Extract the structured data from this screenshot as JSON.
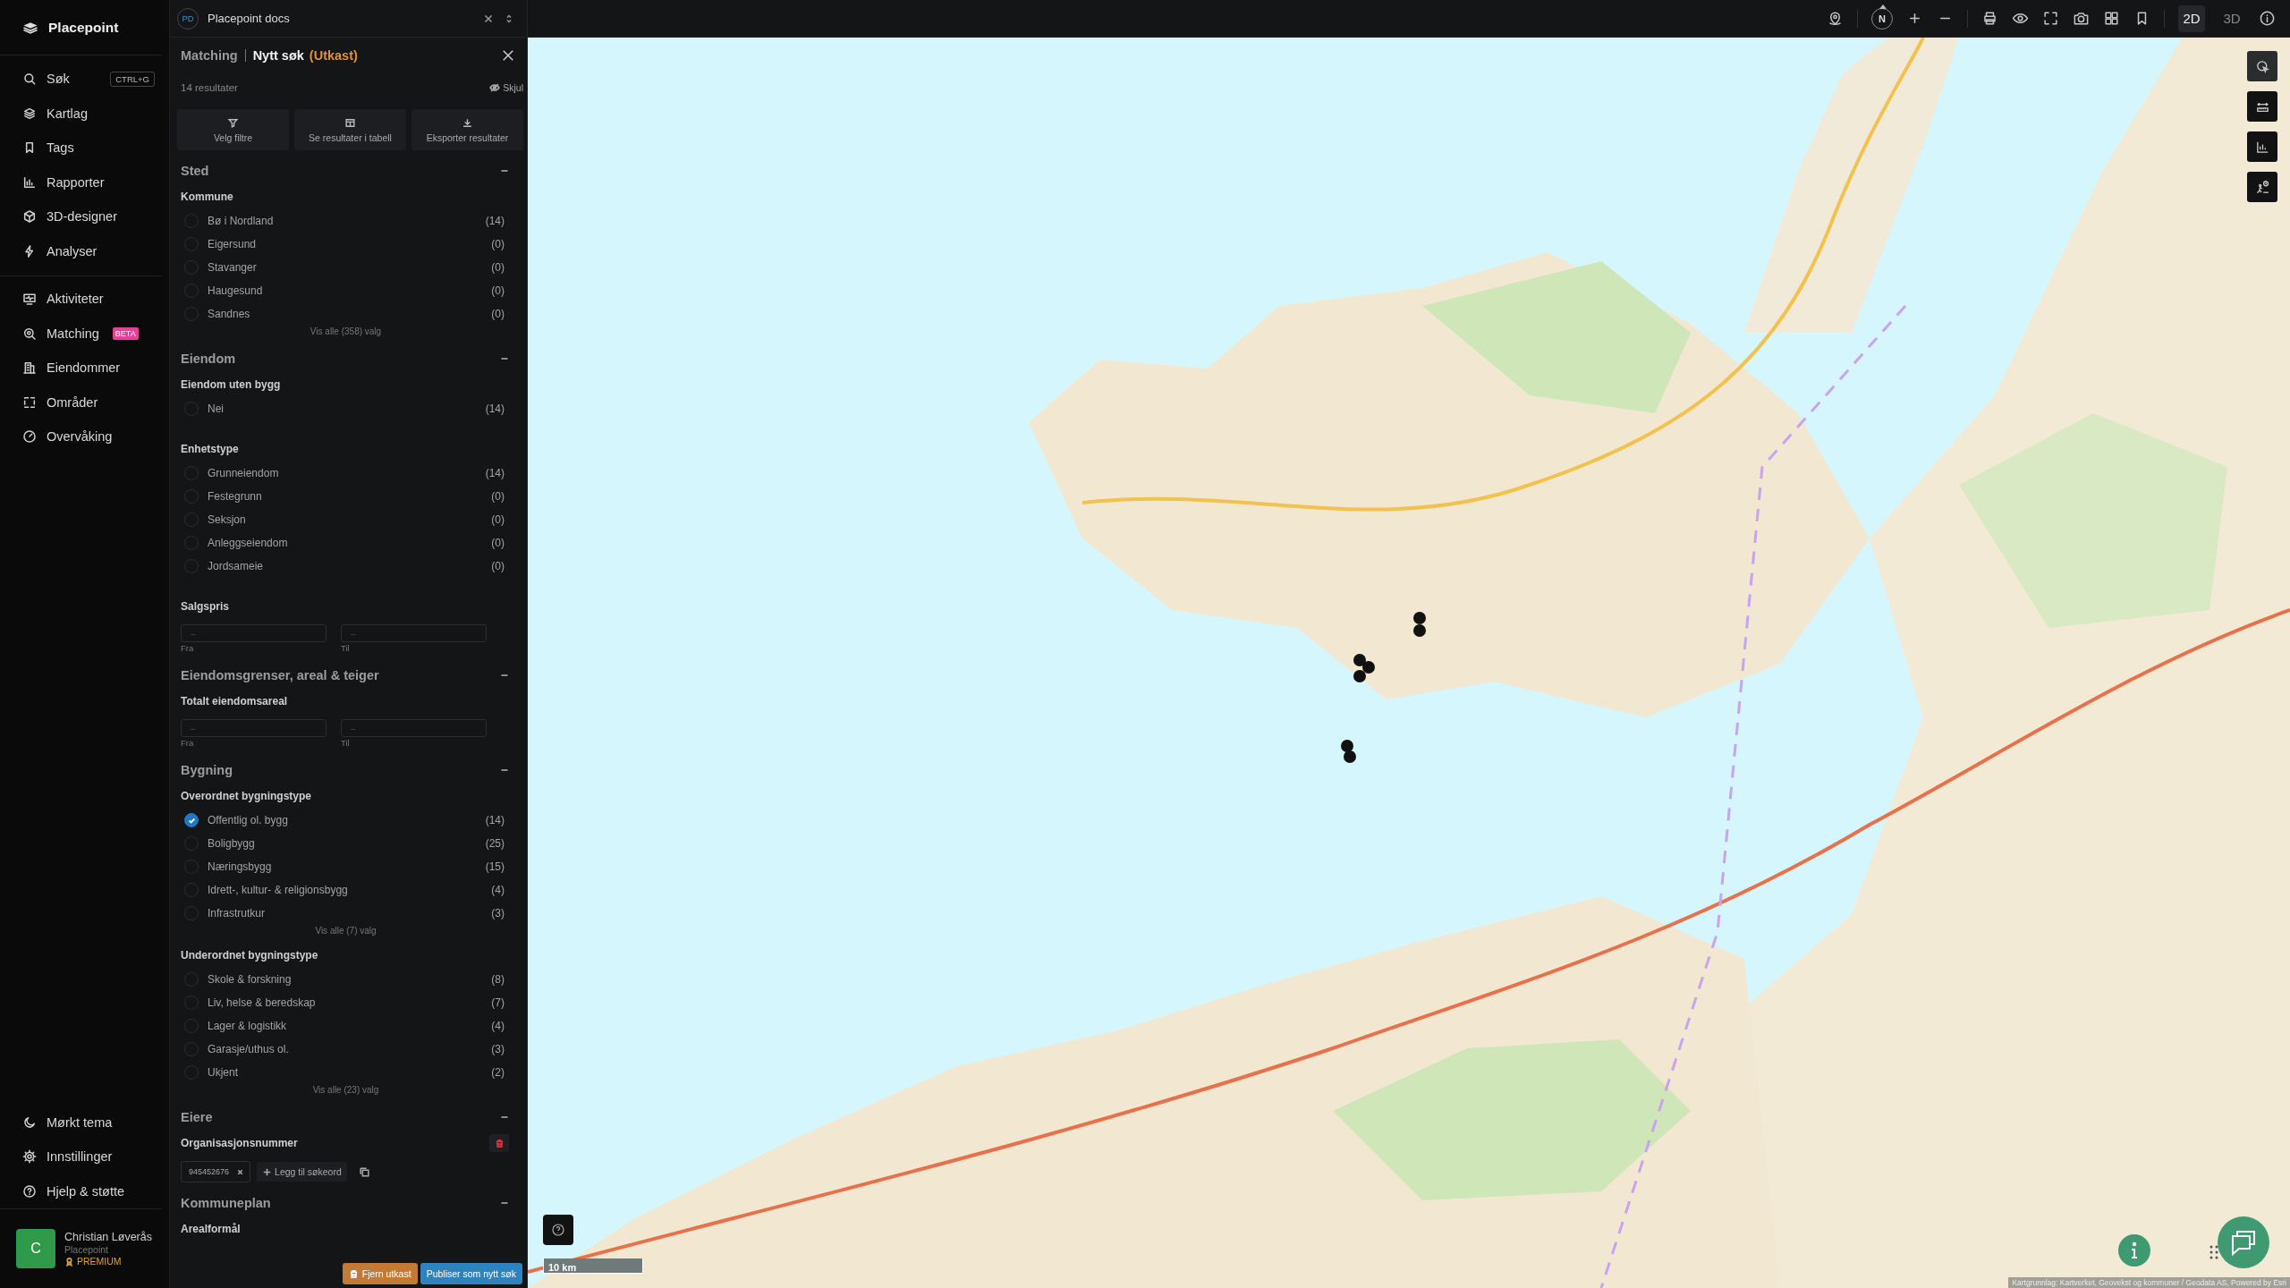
{
  "sidebar": {
    "brand": "Placepoint",
    "nav_groups": [
      {
        "items": [
          {
            "label": "Søk",
            "shortcut": "CTRL+G"
          },
          {
            "label": "Kartlag"
          },
          {
            "label": "Tags"
          },
          {
            "label": "Rapporter"
          },
          {
            "label": "3D-designer"
          },
          {
            "label": "Analyser"
          }
        ]
      },
      {
        "items": [
          {
            "label": "Aktiviteter"
          },
          {
            "label": "Matching",
            "badge": "BETA"
          },
          {
            "label": "Eiendommer"
          },
          {
            "label": "Områder"
          },
          {
            "label": "Overvåking"
          }
        ]
      }
    ],
    "footer_items": [
      {
        "label": "Mørkt tema"
      },
      {
        "label": "Innstillinger"
      },
      {
        "label": "Hjelp & støtte"
      }
    ],
    "user": {
      "initial": "C",
      "name": "Christian Løverås",
      "org": "Placepoint",
      "plan": "PREMIUM"
    }
  },
  "document_tab": {
    "initials": "PD",
    "title": "Placepoint docs"
  },
  "toolbar": {
    "compass": "N",
    "view_modes": [
      {
        "label": "2D",
        "selected": true
      },
      {
        "label": "3D",
        "selected": false
      }
    ]
  },
  "panel": {
    "breadcrumb": "Matching",
    "title": "Nytt søk",
    "status": "(Utkast)",
    "results": "14 resultater",
    "hide": "Skjul",
    "actions": [
      "Velg filtre",
      "Se resultater i tabell",
      "Eksporter resultater"
    ],
    "sections": [
      {
        "title": "Sted",
        "expanded": true,
        "groups": [
          {
            "kind": "options",
            "title": "Kommune",
            "show_all": "Vis alle (358) valg",
            "options": [
              {
                "label": "Bø i Nordland",
                "count": "(14)",
                "checked": false
              },
              {
                "label": "Eigersund",
                "count": "(0)",
                "checked": false
              },
              {
                "label": "Stavanger",
                "count": "(0)",
                "checked": false
              },
              {
                "label": "Haugesund",
                "count": "(0)",
                "checked": false
              },
              {
                "label": "Sandnes",
                "count": "(0)",
                "checked": false
              }
            ]
          }
        ]
      },
      {
        "title": "Eiendom",
        "expanded": true,
        "groups": [
          {
            "kind": "options",
            "title": "Eiendom uten bygg",
            "options": [
              {
                "label": "Nei",
                "count": "(14)",
                "checked": false
              }
            ]
          },
          {
            "kind": "options",
            "title": "Enhetstype",
            "options": [
              {
                "label": "Grunneiendom",
                "count": "(14)",
                "checked": false
              },
              {
                "label": "Festegrunn",
                "count": "(0)",
                "checked": false
              },
              {
                "label": "Seksjon",
                "count": "(0)",
                "checked": false
              },
              {
                "label": "Anleggseiendom",
                "count": "(0)",
                "checked": false
              },
              {
                "label": "Jordsameie",
                "count": "(0)",
                "checked": false
              }
            ]
          },
          {
            "kind": "range",
            "title": "Salgspris",
            "from_placeholder": "–",
            "to_placeholder": "–",
            "from_label": "Fra",
            "to_label": "Til"
          }
        ]
      },
      {
        "title": "Eiendomsgrenser, areal & teiger",
        "expanded": true,
        "groups": [
          {
            "kind": "range",
            "title": "Totalt eiendomsareal",
            "from_placeholder": "–",
            "to_placeholder": "–",
            "from_label": "Fra",
            "to_label": "Til"
          }
        ]
      },
      {
        "title": "Bygning",
        "expanded": true,
        "groups": [
          {
            "kind": "options",
            "title": "Overordnet bygningstype",
            "show_all": "Vis alle (7) valg",
            "options": [
              {
                "label": "Offentlig ol. bygg",
                "count": "(14)",
                "checked": true
              },
              {
                "label": "Boligbygg",
                "count": "(25)",
                "checked": false
              },
              {
                "label": "Næringsbygg",
                "count": "(15)",
                "checked": false
              },
              {
                "label": "Idrett-, kultur- & religionsbygg",
                "count": "(4)",
                "checked": false
              },
              {
                "label": "Infrastrutkur",
                "count": "(3)",
                "checked": false
              }
            ]
          },
          {
            "kind": "options",
            "title": "Underordnet bygningstype",
            "show_all": "Vis alle (23) valg",
            "options": [
              {
                "label": "Skole & forskning",
                "count": "(8)",
                "checked": false
              },
              {
                "label": "Liv, helse & beredskap",
                "count": "(7)",
                "checked": false
              },
              {
                "label": "Lager & logistikk",
                "count": "(4)",
                "checked": false
              },
              {
                "label": "Garasje/uthus ol.",
                "count": "(3)",
                "checked": false
              },
              {
                "label": "Ukjent",
                "count": "(2)",
                "checked": false
              }
            ]
          }
        ]
      },
      {
        "title": "Eiere",
        "expanded": true,
        "groups": [
          {
            "kind": "tags",
            "title": "Organisasjonsnummer",
            "tags": [
              "945452676"
            ],
            "add": "Legg til søkeord"
          }
        ]
      },
      {
        "title": "Kommuneplan",
        "expanded": true,
        "groups": [
          {
            "kind": "options",
            "title": "Arealformål"
          }
        ]
      }
    ],
    "buttons": {
      "remove": "Fjern utkast",
      "publish": "Publiser som nytt søk"
    }
  },
  "map": {
    "tools": [
      {
        "selected": true
      },
      {
        "selected": false
      },
      {
        "selected": false
      },
      {
        "selected": false
      }
    ],
    "scale": "10 km",
    "attribution": "Kartgrunnlag: Kartverket, Geovekst og kommuner / Geodata AS, Powered by Esri"
  }
}
